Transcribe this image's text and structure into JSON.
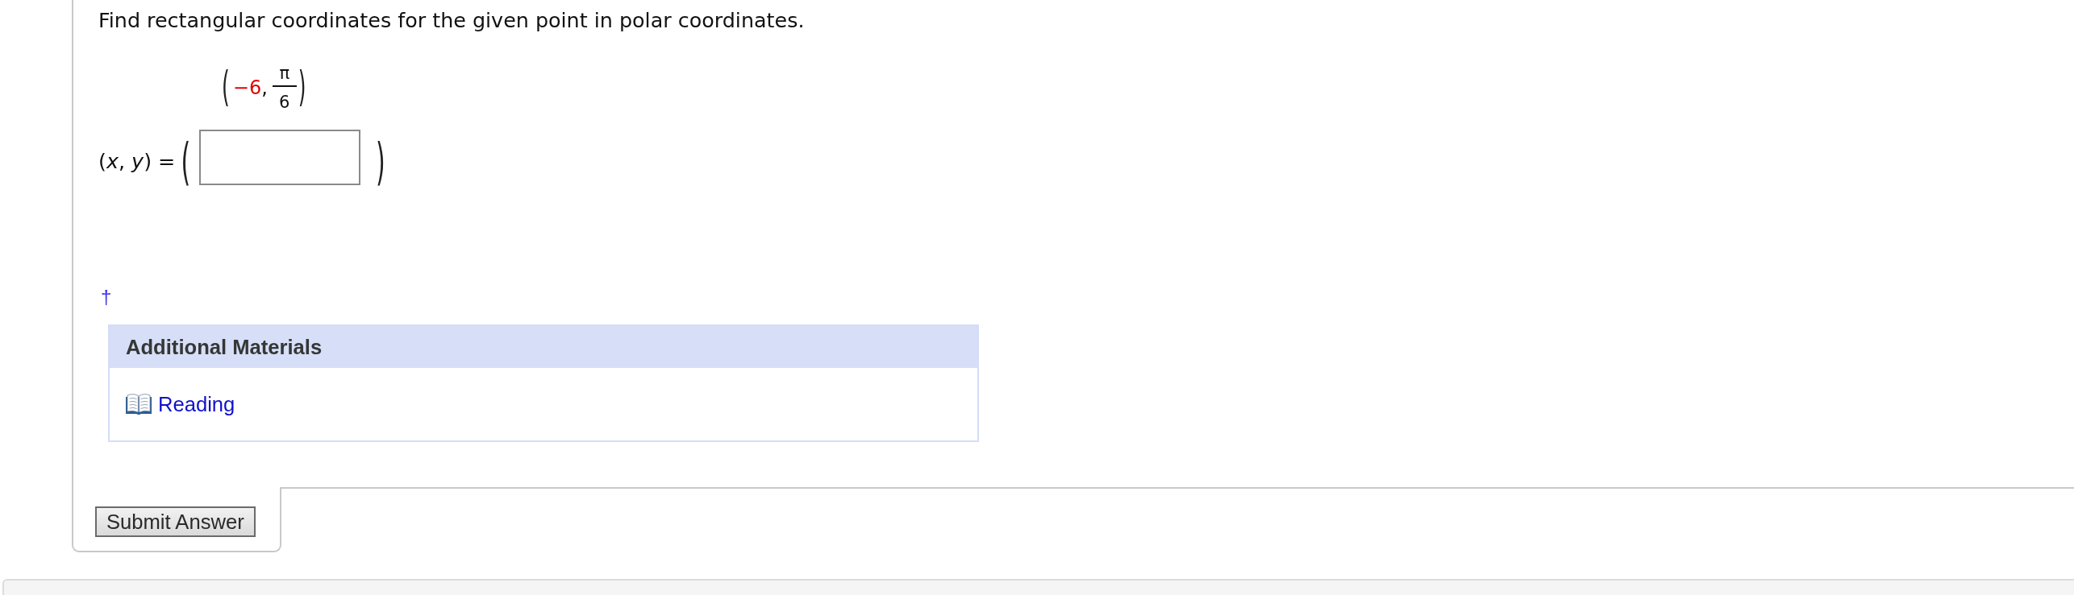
{
  "question": {
    "prompt": "Find rectangular coordinates for the given point in polar coordinates.",
    "point": {
      "open": "(",
      "r": {
        "text": "−6",
        "highlighted": true
      },
      "separator": ",",
      "theta": {
        "numerator": "π",
        "denominator": "6"
      },
      "close": ")"
    },
    "answer": {
      "label": "(*x*, *y*) =",
      "open": "(",
      "close": ")"
    },
    "footnote": "†"
  },
  "additional_materials": {
    "title": "Additional Materials",
    "items": [
      {
        "label": "Reading"
      }
    ]
  },
  "submit_button": "Submit Answer"
}
